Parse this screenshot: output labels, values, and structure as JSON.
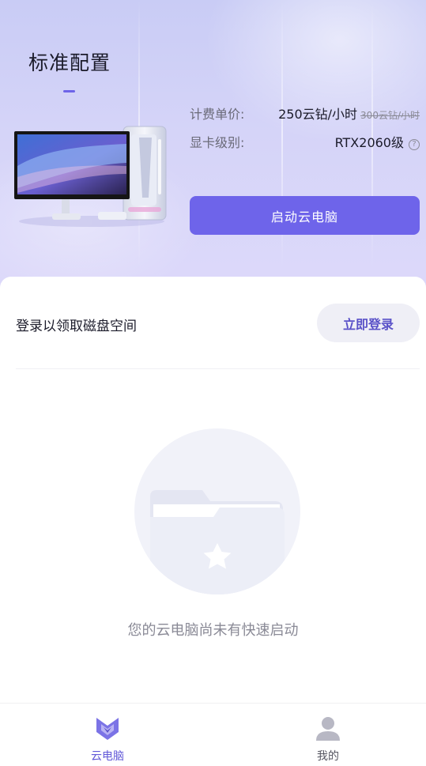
{
  "header": {
    "title": "标准配置",
    "price_label": "计费单价:",
    "price_value": "250云钻/小时",
    "original_price": "300云钻/小时",
    "gpu_label": "显卡级别:",
    "gpu_value": "RTX2060级",
    "help_icon": "question-circle-icon",
    "start_button": "启动云电脑"
  },
  "login": {
    "prompt": "登录以领取磁盘空间",
    "button": "立即登录"
  },
  "empty_state": {
    "icon": "folder-star-icon",
    "message": "您的云电脑尚未有快速启动"
  },
  "tabbar": {
    "tabs": [
      {
        "label": "云电脑",
        "icon": "cloud-pc-logo-icon",
        "active": true
      },
      {
        "label": "我的",
        "icon": "user-icon",
        "active": false
      }
    ]
  },
  "colors": {
    "accent": "#6e64ea",
    "hero_bg": "#cfd0f7",
    "login_button_bg": "#efeff6",
    "empty_circle": "#f1f2f9"
  }
}
